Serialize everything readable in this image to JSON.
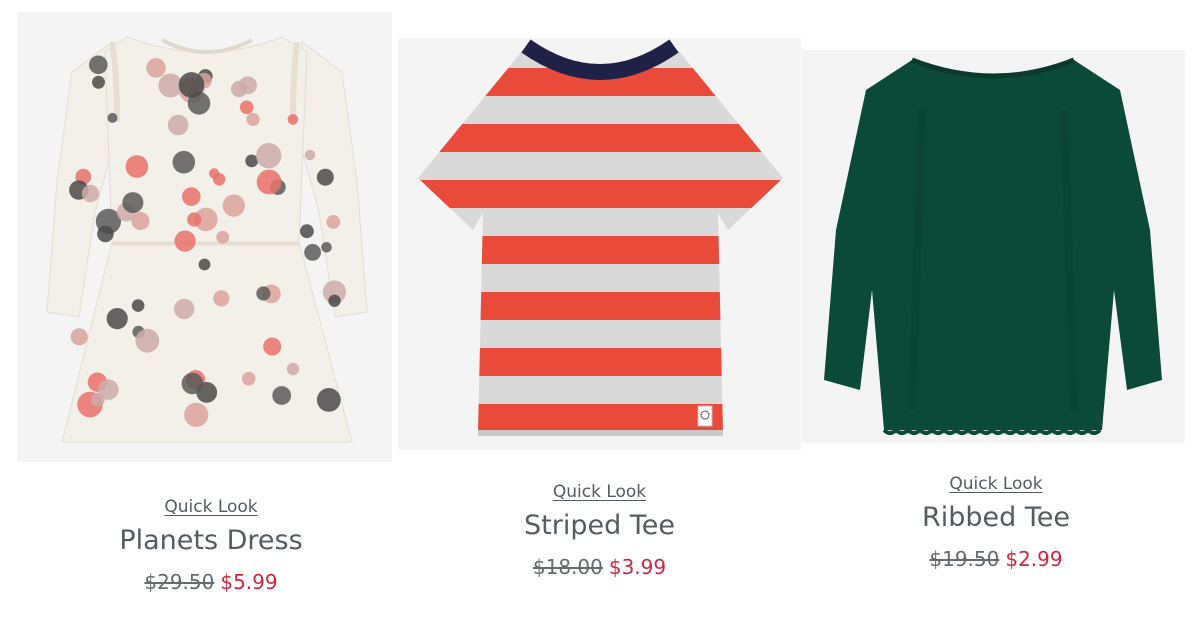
{
  "products": [
    {
      "quick_look": "Quick Look",
      "name": "Planets Dress",
      "was_price": "$29.50",
      "sale_price": "$5.99",
      "image": "planets-dress-image"
    },
    {
      "quick_look": "Quick Look",
      "name": "Striped Tee",
      "was_price": "$18.00",
      "sale_price": "$3.99",
      "image": "striped-tee-image"
    },
    {
      "quick_look": "Quick Look",
      "name": "Ribbed Tee",
      "was_price": "$19.50",
      "sale_price": "$2.99",
      "image": "ribbed-tee-image"
    }
  ],
  "colors": {
    "text": "#555b61",
    "sale": "#d2263f",
    "stripe_red": "#ea4a3a",
    "stripe_grey": "#d9d9d9",
    "collar_navy": "#1f2147",
    "tee_green": "#0c4a38",
    "dress_cream": "#f3efe9"
  }
}
